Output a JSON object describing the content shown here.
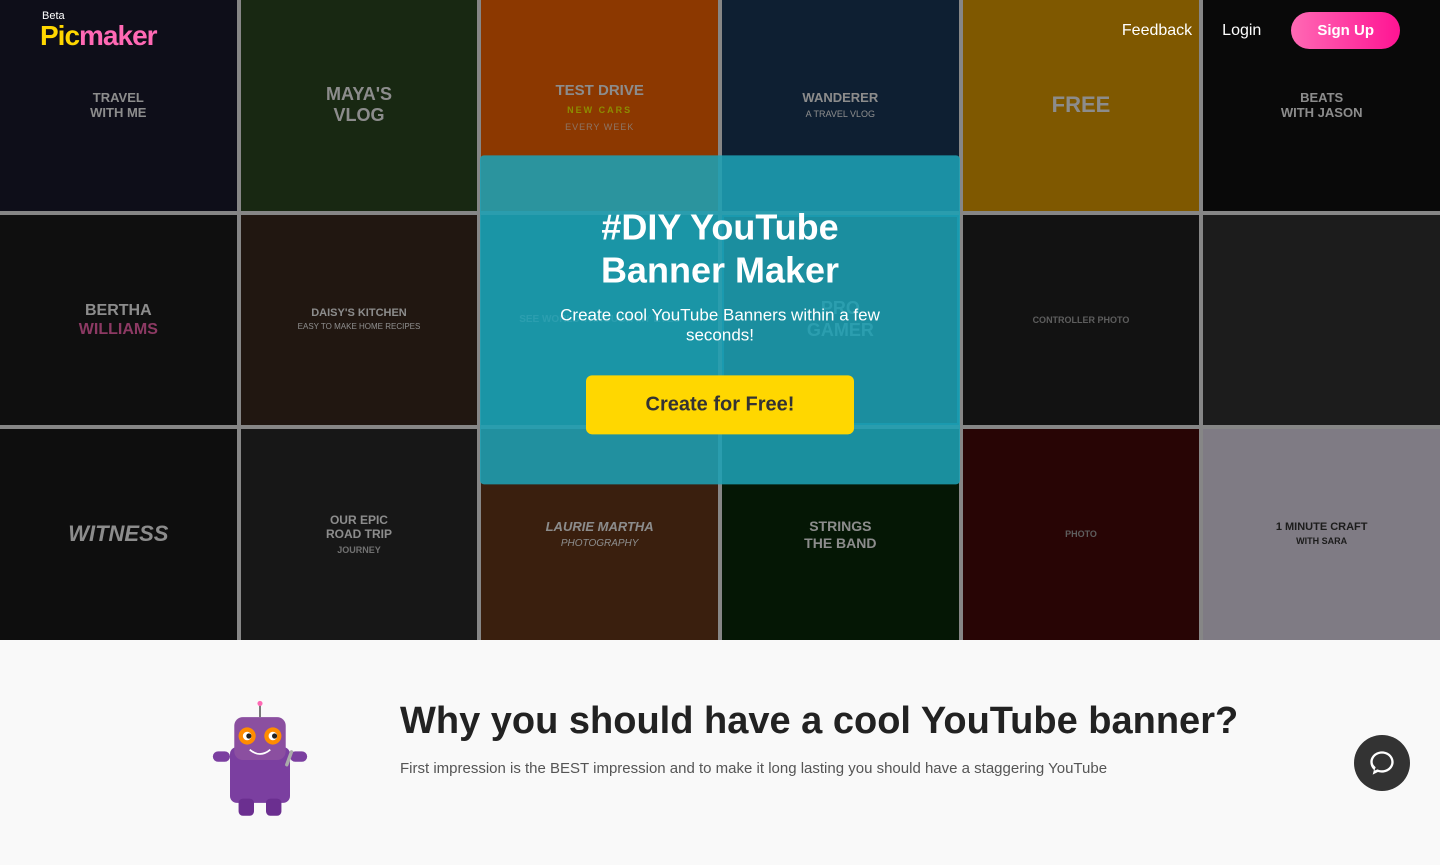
{
  "navbar": {
    "beta_label": "Beta",
    "logo_text": "Picmaker",
    "feedback_label": "Feedback",
    "login_label": "Login",
    "signup_label": "Sign Up"
  },
  "hero": {
    "title": "#DIY YouTube Banner Maker",
    "subtitle": "Create cool YouTube Banners within a few seconds!",
    "cta_label": "Create for Free!"
  },
  "below": {
    "heading": "Why you should have a cool YouTube banner?",
    "description": "First impression is the BEST impression and to make it long lasting you should have a staggering YouTube"
  },
  "banner_cells": [
    {
      "id": 1,
      "text": "TRAVEL WITH ME",
      "sub": "",
      "bg": "#1a2a1a"
    },
    {
      "id": 2,
      "text": "MAYA'S VLOG",
      "sub": "",
      "bg": "#1a1a2e"
    },
    {
      "id": 3,
      "text": "TEST DRIVE NEW CARS",
      "sub": "EVERY WEEK",
      "bg": "#2c1810"
    },
    {
      "id": 4,
      "text": "WANDERER",
      "sub": "A Travel Vlog",
      "bg": "#0d1b2a"
    },
    {
      "id": 5,
      "text": "FREE",
      "sub": "",
      "bg": "#e8a000"
    },
    {
      "id": 6,
      "text": "BEATS WITH JASON",
      "sub": "",
      "bg": "#111"
    },
    {
      "id": 7,
      "text": "BERTHA WILLIAMS",
      "sub": "",
      "bg": "#1c1c1c"
    },
    {
      "id": 8,
      "text": "DAISY'S KITCHEN",
      "sub": "Easy to Make Home Recipes",
      "bg": "#3d2b1f"
    },
    {
      "id": 9,
      "text": "SEE WORLD THROUGH MY EYES",
      "sub": "",
      "bg": "#008080"
    },
    {
      "id": 10,
      "text": "PRO GAMER",
      "sub": "",
      "bg": "#111"
    },
    {
      "id": 11,
      "text": "",
      "sub": "",
      "bg": "#222"
    },
    {
      "id": 12,
      "text": "",
      "sub": "",
      "bg": "#333"
    },
    {
      "id": 13,
      "text": "Witness",
      "sub": "",
      "bg": "#1a1a1a"
    },
    {
      "id": 14,
      "text": "OUR EPIC ROAD TRIP JOURNEY",
      "sub": "",
      "bg": "#2a2a2a"
    },
    {
      "id": 15,
      "text": "Laurie Martha Photography",
      "sub": "",
      "bg": "#6a3a1a"
    },
    {
      "id": 16,
      "text": "STRINGS THE BAND",
      "sub": "",
      "bg": "#0a2a0a"
    },
    {
      "id": 17,
      "text": "",
      "sub": "",
      "bg": "#4a0a0a"
    },
    {
      "id": 18,
      "text": "1 MINUTE CRAFT WITH SARA",
      "sub": "",
      "bg": "#6a2a6a"
    }
  ],
  "chat": {
    "icon": "chat"
  }
}
